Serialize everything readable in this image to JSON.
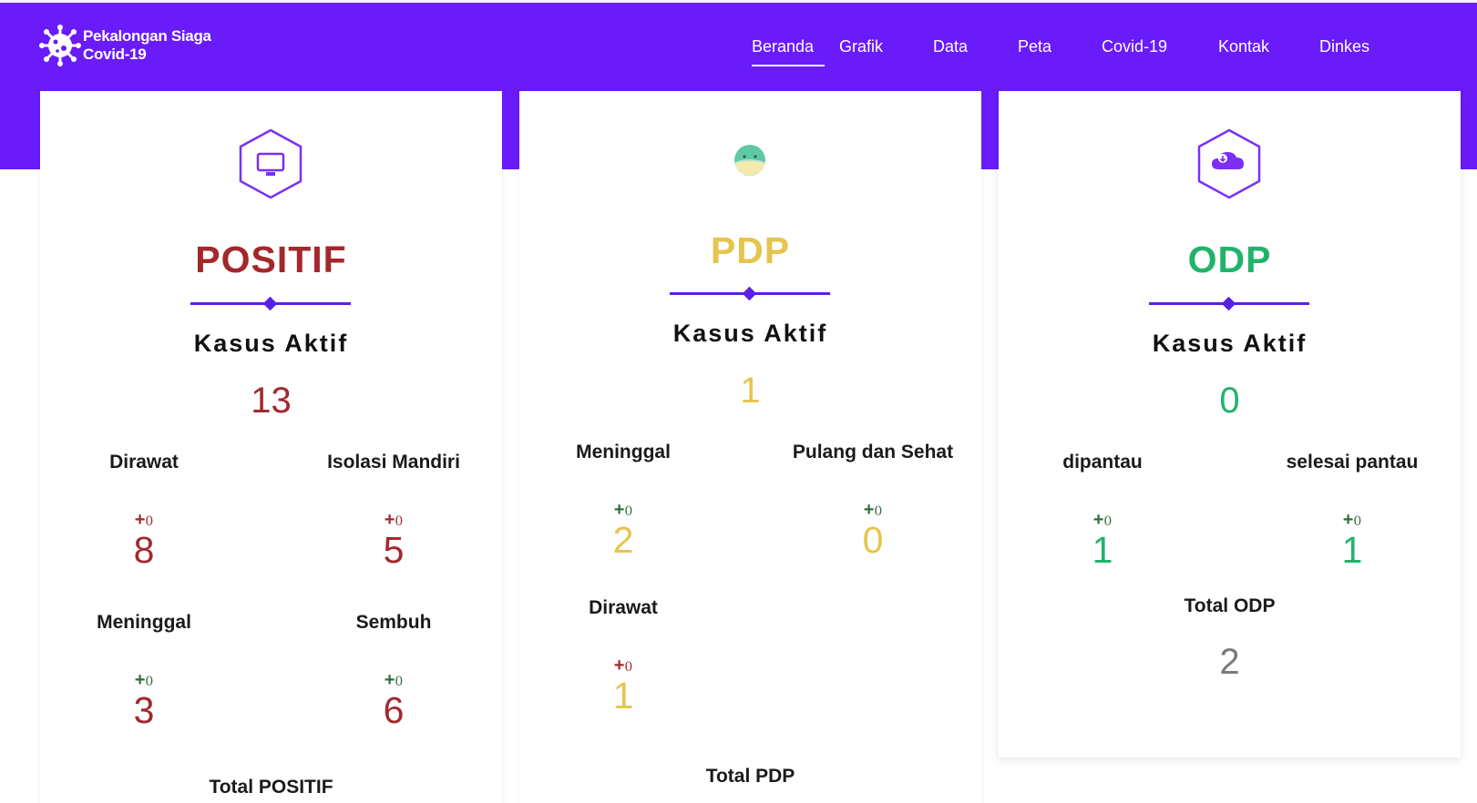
{
  "app": {
    "brand_text": "Pekalongan Siaga\nCovid-19",
    "logo_icon": "virus-icon"
  },
  "nav": [
    {
      "label": "Beranda",
      "active": true
    },
    {
      "label": "Grafik"
    },
    {
      "label": "Data"
    },
    {
      "label": "Peta"
    },
    {
      "label": "Covid-19"
    },
    {
      "label": "Kontak"
    },
    {
      "label": "Dinkes"
    }
  ],
  "colors": {
    "primary": "#6a1bfa",
    "positif": "#a3282c",
    "pdp": "#e6c54e",
    "odp": "#22b36b",
    "green_delta": "#2f6f3b",
    "red_delta": "#a3282c",
    "gray_total": "#7a7a7a"
  },
  "positif": {
    "icon": "monitor-icon",
    "title": "POSITIF",
    "kasus_label": "Kasus Aktif",
    "kasus_value": "13",
    "dirawat_label": "Dirawat",
    "dirawat_delta_sign": "+",
    "dirawat_delta": "0",
    "dirawat_value": "8",
    "isolasi_label": "Isolasi Mandiri",
    "isolasi_delta_sign": "+",
    "isolasi_delta": "0",
    "isolasi_value": "5",
    "meninggal_label": "Meninggal",
    "meninggal_delta_sign": "+",
    "meninggal_delta": "0",
    "meninggal_value": "3",
    "sembuh_label": "Sembuh",
    "sembuh_delta_sign": "+",
    "sembuh_delta": "0",
    "sembuh_value": "6",
    "total_label": "Total POSITIF"
  },
  "pdp": {
    "icon": "masked-face-icon",
    "title": "PDP",
    "kasus_label": "Kasus Aktif",
    "kasus_value": "1",
    "meninggal_label": "Meninggal",
    "meninggal_delta_sign": "+",
    "meninggal_delta": "0",
    "meninggal_value": "2",
    "pulang_label": "Pulang dan Sehat",
    "pulang_delta_sign": "+",
    "pulang_delta": "0",
    "pulang_value": "0",
    "dirawat_label": "Dirawat",
    "dirawat_delta_sign": "+",
    "dirawat_delta": "0",
    "dirawat_value": "1",
    "total_label": "Total PDP"
  },
  "odp": {
    "icon": "cloud-download-icon",
    "title": "ODP",
    "kasus_label": "Kasus Aktif",
    "kasus_value": "0",
    "dipantau_label": "dipantau",
    "dipantau_delta_sign": "+",
    "dipantau_delta": "0",
    "dipantau_value": "1",
    "selesai_label": "selesai pantau",
    "selesai_delta_sign": "+",
    "selesai_delta": "0",
    "selesai_value": "1",
    "total_label": "Total ODP",
    "total_value": "2"
  }
}
